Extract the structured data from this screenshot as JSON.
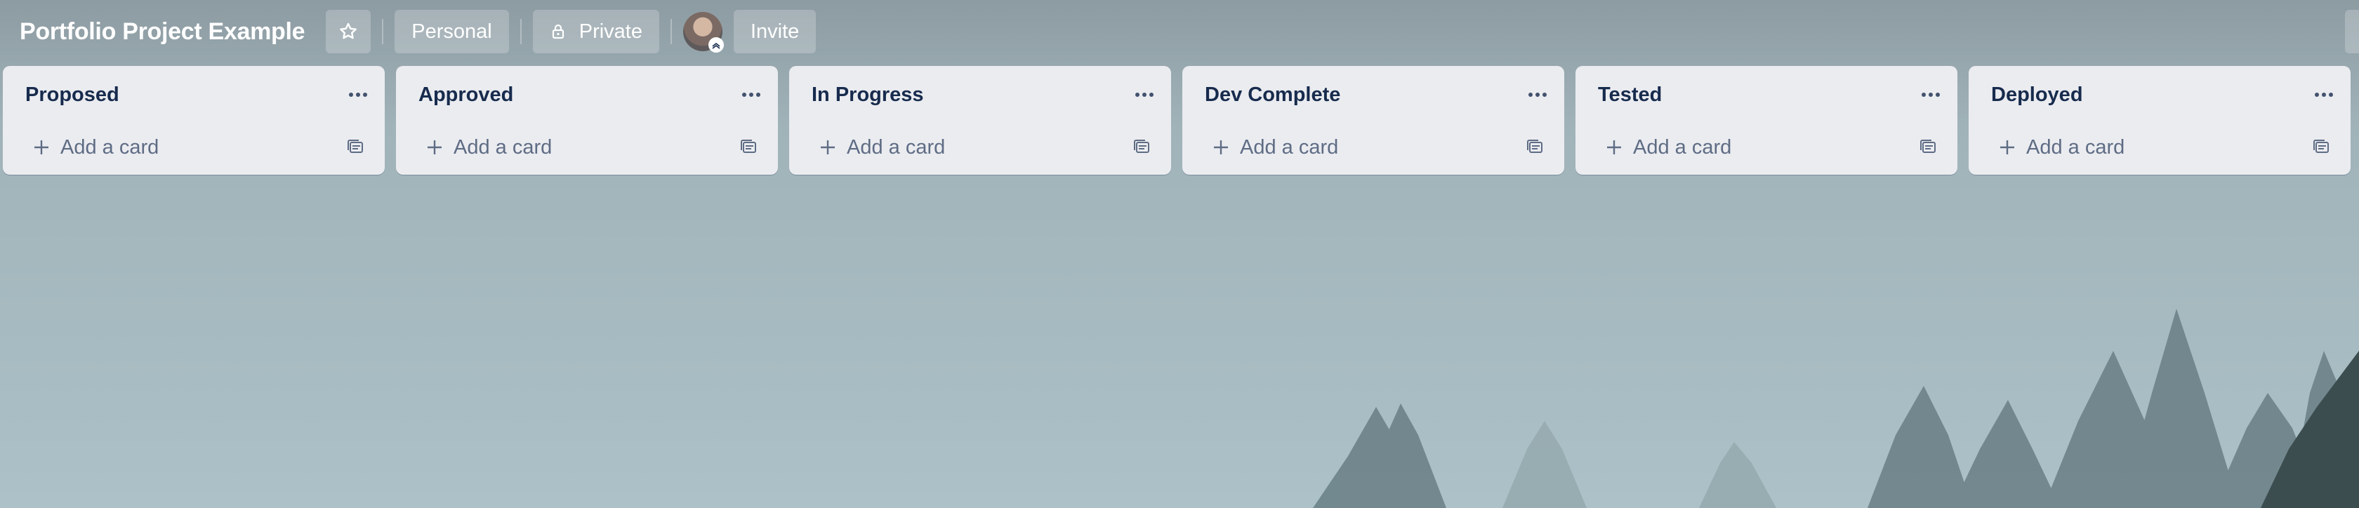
{
  "board": {
    "title": "Portfolio Project Example",
    "workspace_label": "Personal",
    "visibility_label": "Private",
    "invite_label": "Invite"
  },
  "icons": {
    "star": "star-icon",
    "lock": "lock-icon",
    "menu": "more-horizontal-icon",
    "add": "plus-icon",
    "template": "card-template-icon"
  },
  "lists": [
    {
      "title": "Proposed",
      "add_label": "Add a card"
    },
    {
      "title": "Approved",
      "add_label": "Add a card"
    },
    {
      "title": "In Progress",
      "add_label": "Add a card"
    },
    {
      "title": "Dev Complete",
      "add_label": "Add a card"
    },
    {
      "title": "Tested",
      "add_label": "Add a card"
    },
    {
      "title": "Deployed",
      "add_label": "Add a card"
    }
  ],
  "colors": {
    "list_bg": "#ebecf0",
    "list_title": "#172b4d",
    "muted_text": "#5e6c84",
    "header_text": "#ffffff"
  }
}
